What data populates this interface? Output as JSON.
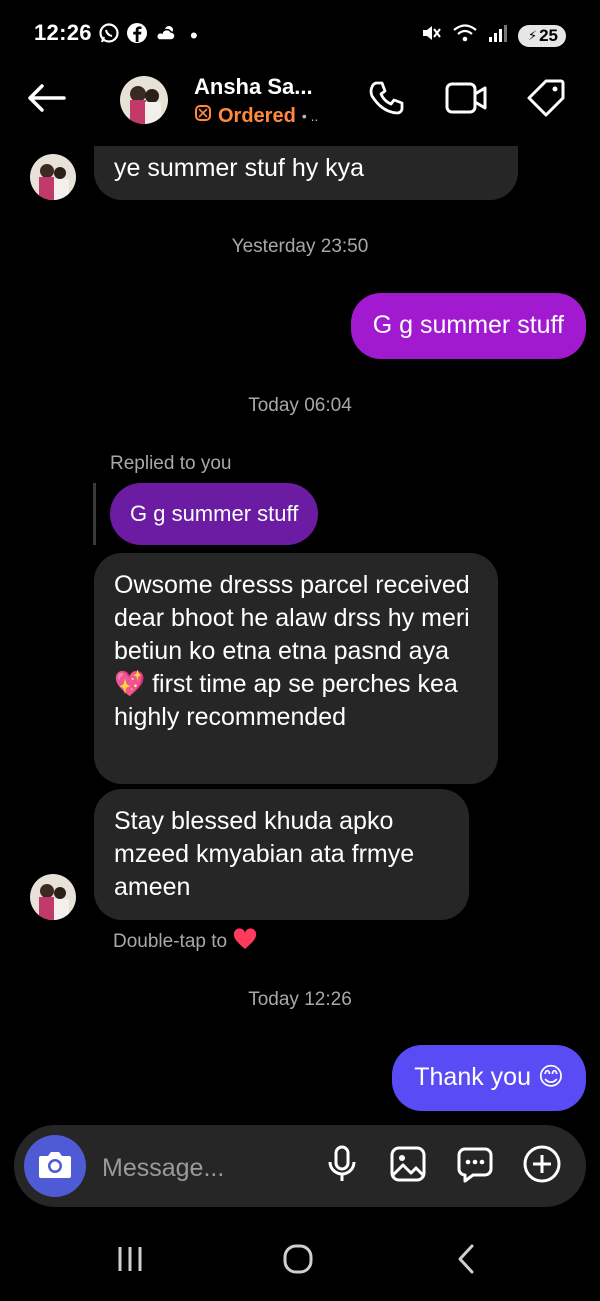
{
  "status_bar": {
    "time": "12:26",
    "battery": "25",
    "icons": [
      "whatsapp-icon",
      "facebook-icon",
      "weather-icon",
      "dot-icon",
      "mute-icon",
      "wifi-icon",
      "signal-icon",
      "battery-icon"
    ]
  },
  "header": {
    "name": "Ansha Sa...",
    "status_label": "Ordered",
    "status_dots": "• ..",
    "status_color": "#ff8a3d",
    "icons": [
      "back-arrow-icon",
      "phone-icon",
      "video-icon",
      "tag-icon"
    ]
  },
  "messages": {
    "partial_incoming": "ye summer stuf hy kya",
    "ts1": "Yesterday 23:50",
    "out1": "G g summer stuff",
    "ts2": "Today 06:04",
    "reply_label": "Replied to you",
    "reply_quote": "G g summer stuff",
    "in_long": "Owsome  dresss parcel received  dear bhoot he alaw drss hy meri betiun ko etna etna pasnd aya 💖  first time ap se perches kea highly recommended",
    "in_short": "Stay blessed  khuda apko mzeed kmyabian ata frmye ameen",
    "double_tap": "Double-tap to",
    "ts3": "Today 12:26",
    "out2": "Thank you 😊"
  },
  "composer": {
    "placeholder": "Message...",
    "icons": [
      "camera-icon",
      "microphone-icon",
      "gallery-icon",
      "sticker-icon",
      "plus-icon"
    ]
  },
  "colors": {
    "outgoing_purple": "#a21ad0",
    "outgoing_blue": "#5a4cf5",
    "reply_quote": "#6c1ca3",
    "incoming": "#262626"
  },
  "nav": {
    "icons": [
      "recent-apps-icon",
      "home-icon",
      "back-nav-icon"
    ]
  }
}
